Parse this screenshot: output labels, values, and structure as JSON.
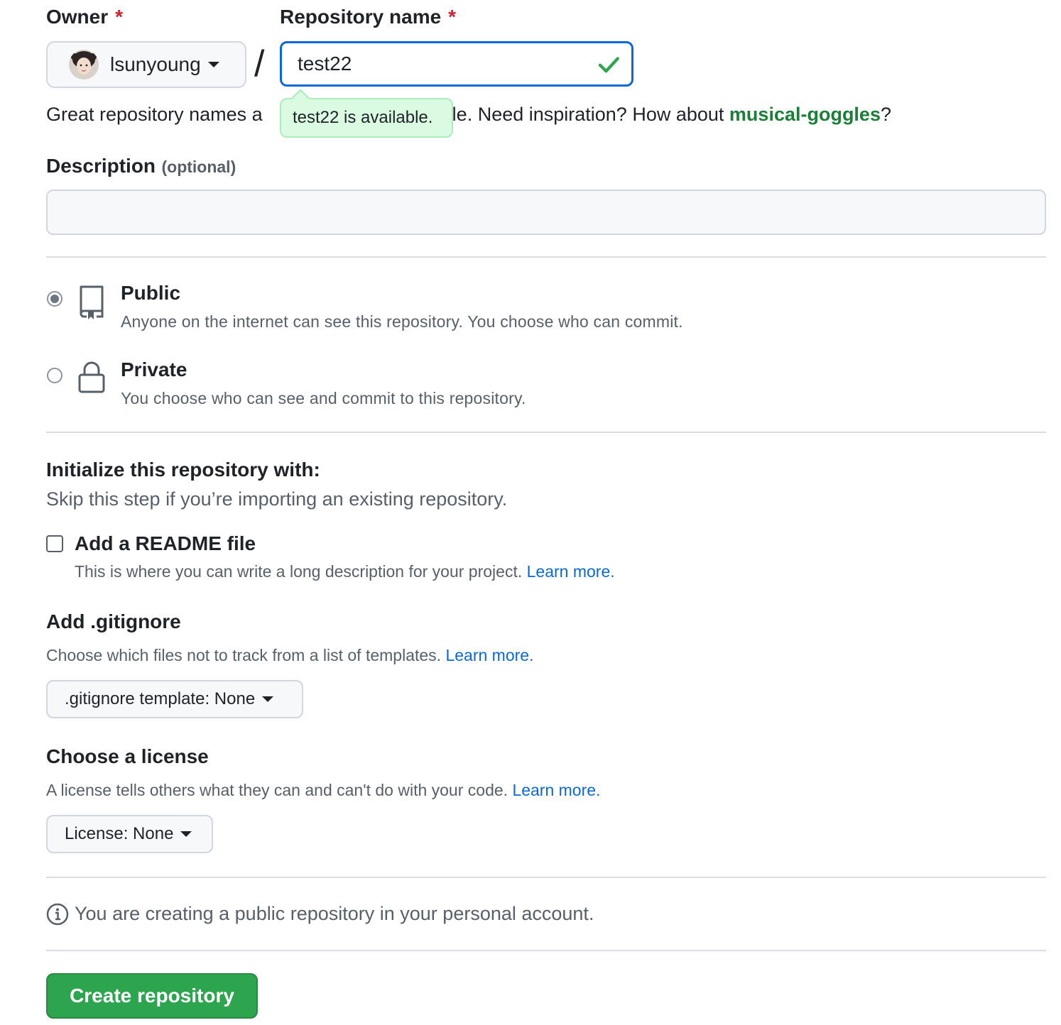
{
  "owner": {
    "label": "Owner",
    "required_mark": "*",
    "name": "lsunyoung"
  },
  "repo_name": {
    "label": "Repository name",
    "required_mark": "*",
    "value": "test22",
    "separator": "/",
    "availability_tooltip": "test22 is available."
  },
  "suggestion": {
    "text_prefix": "Great repository names a",
    "text_suffix": "able. Need inspiration? How about ",
    "suggested_name": "musical-goggles",
    "text_end": "?"
  },
  "description": {
    "label": "Description",
    "optional_note": "(optional)",
    "value": ""
  },
  "visibility": {
    "public": {
      "title": "Public",
      "description": "Anyone on the internet can see this repository. You choose who can commit.",
      "selected": true
    },
    "private": {
      "title": "Private",
      "description": "You choose who can see and commit to this repository.",
      "selected": false
    }
  },
  "initialize": {
    "heading": "Initialize this repository with:",
    "subtext": "Skip this step if you’re importing an existing repository.",
    "readme": {
      "label": "Add a README file",
      "description": "This is where you can write a long description for your project.",
      "link": "Learn more.",
      "checked": false
    }
  },
  "gitignore": {
    "heading": "Add .gitignore",
    "description": "Choose which files not to track from a list of templates.",
    "link": "Learn more.",
    "dropdown_label": ".gitignore template: None"
  },
  "license": {
    "heading": "Choose a license",
    "description": "A license tells others what they can and can't do with your code.",
    "link": "Learn more.",
    "dropdown_label": "License: None"
  },
  "notice": {
    "text": "You are creating a public repository in your personal account."
  },
  "submit": {
    "label": "Create repository"
  },
  "colors": {
    "primary_button": "#2da44e",
    "link": "#0969da",
    "suggestion": "#1a7f37",
    "required": "#cf222e",
    "focus_border": "#0969da",
    "success_tooltip_bg": "#dafbe1"
  }
}
